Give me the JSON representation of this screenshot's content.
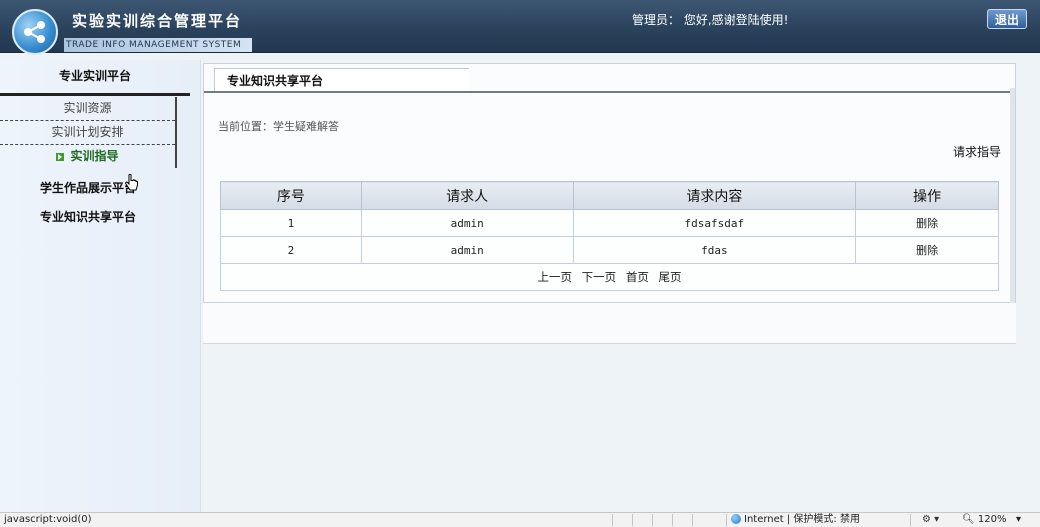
{
  "header": {
    "title": "实验实训综合管理平台",
    "subtitle": "TRADE INFO MANAGEMENT SYSTEM",
    "welcome": "管理员： 您好,感谢登陆使用!",
    "logout_label": "退出"
  },
  "sidebar": {
    "heading": "专业实训平台",
    "items": [
      {
        "label": "实训资源"
      },
      {
        "label": "实训计划安排"
      },
      {
        "label": "实训指导",
        "active": true
      }
    ],
    "links": [
      {
        "label": "学生作品展示平台"
      },
      {
        "label": "专业知识共享平台"
      }
    ]
  },
  "main": {
    "tab_label": "专业知识共享平台",
    "breadcrumb": "当前位置：学生疑难解答",
    "request_link": "请求指导",
    "table": {
      "columns": [
        "序号",
        "请求人",
        "请求内容",
        "操作"
      ],
      "rows": [
        {
          "index": "1",
          "requester": "admin",
          "content": "fdsafsdaf",
          "action": "删除"
        },
        {
          "index": "2",
          "requester": "admin",
          "content": "fdas",
          "action": "删除"
        }
      ],
      "pager": {
        "prev": "上一页",
        "next": "下一页",
        "first": "首页",
        "last": "尾页"
      }
    }
  },
  "statusbar": {
    "left_text": "javascript:void(0)",
    "zone": "Internet | 保护模式: 禁用",
    "zoom": "120%"
  },
  "colors": {
    "header_bg": "#2b425c",
    "accent_green": "#3e9a2a"
  }
}
